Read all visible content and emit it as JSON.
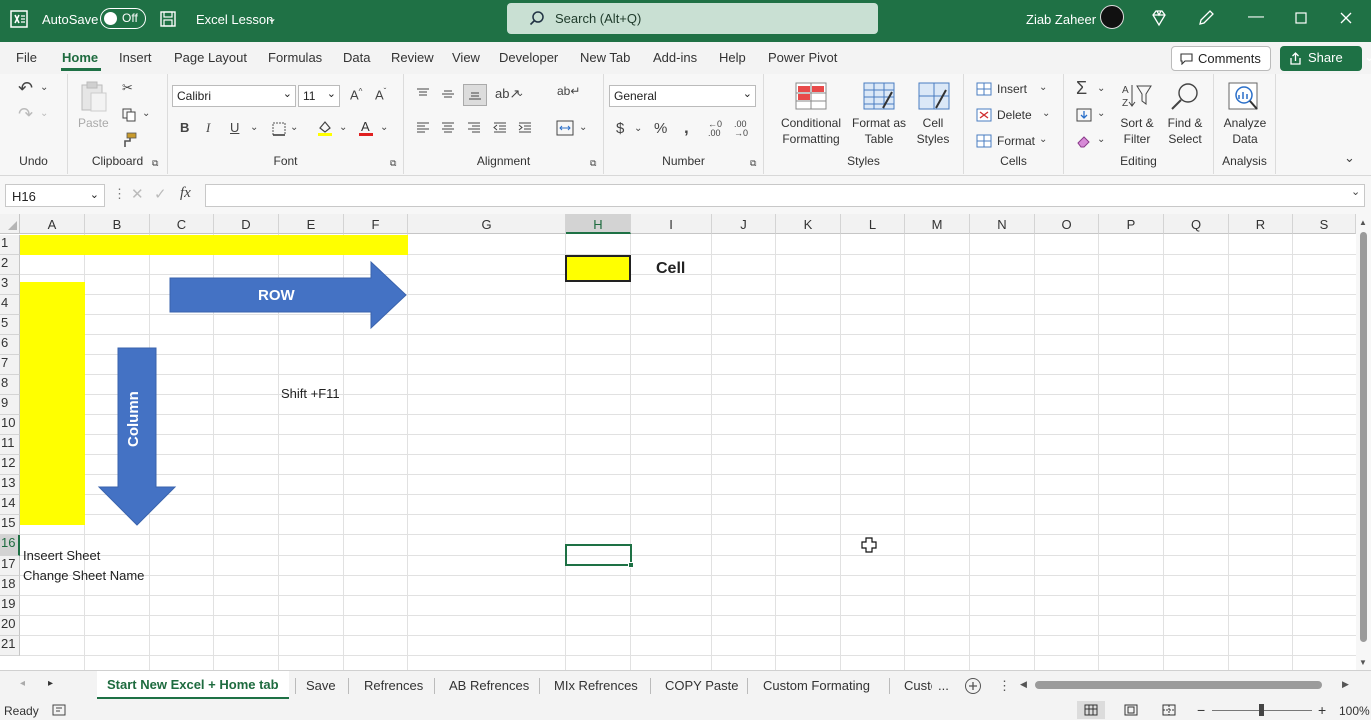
{
  "title_bar": {
    "autosave_label": "AutoSave",
    "autosave_state": "Off",
    "file_name": "Excel Lesson",
    "search_placeholder": "Search (Alt+Q)",
    "user_name": "Ziab Zaheer"
  },
  "menu": {
    "tabs": [
      "File",
      "Home",
      "Insert",
      "Page Layout",
      "Formulas",
      "Data",
      "Review",
      "View",
      "Developer",
      "New Tab",
      "Add-ins",
      "Help",
      "Power Pivot"
    ],
    "active_tab": "Home",
    "comments_label": "Comments",
    "share_label": "Share"
  },
  "ribbon": {
    "groups": [
      "Undo",
      "Clipboard",
      "Font",
      "Alignment",
      "Number",
      "Styles",
      "Cells",
      "Editing",
      "Analysis"
    ],
    "paste_label": "Paste",
    "font_name": "Calibri",
    "font_size": "11",
    "number_format": "General",
    "conditional_formatting": [
      "Conditional",
      "Formatting"
    ],
    "format_as_table": [
      "Format as",
      "Table"
    ],
    "cell_styles": [
      "Cell",
      "Styles"
    ],
    "cells_buttons": [
      "Insert",
      "Delete",
      "Format"
    ],
    "sort_filter": [
      "Sort &",
      "Filter"
    ],
    "find_select": [
      "Find &",
      "Select"
    ],
    "analyze_data": [
      "Analyze",
      "Data"
    ]
  },
  "formula_bar": {
    "name_box": "H16",
    "fx_label": "fx",
    "formula": ""
  },
  "sheet": {
    "columns": [
      "A",
      "B",
      "C",
      "D",
      "E",
      "F",
      "G",
      "H",
      "I",
      "J",
      "K",
      "L",
      "M",
      "N",
      "O",
      "P",
      "Q",
      "R",
      "S"
    ],
    "rows": [
      "1",
      "2",
      "3",
      "4",
      "5",
      "6",
      "7",
      "8",
      "9",
      "10",
      "11",
      "12",
      "13",
      "14",
      "15",
      "16",
      "17",
      "18",
      "19",
      "20",
      "21"
    ],
    "selected_cell": "H16",
    "row_arrow_label": "ROW",
    "column_arrow_label": "Column",
    "cell_label": "Cell",
    "shortcut_note": "Shift +F11",
    "a16": "Inseert Sheet",
    "a17": "Change Sheet Name",
    "highlight_color": "#ffff00",
    "arrow_color": "#4472c4"
  },
  "sheet_tabs": {
    "tabs": [
      "Start New Excel + Home tab",
      "Save",
      "Refrences",
      "AB Refrences",
      "MIx Refrences",
      "COPY Paste",
      "Custom Formating",
      "Custo"
    ],
    "active": "Start New Excel + Home tab",
    "more": "..."
  },
  "status_bar": {
    "status": "Ready",
    "zoom": "100%"
  }
}
